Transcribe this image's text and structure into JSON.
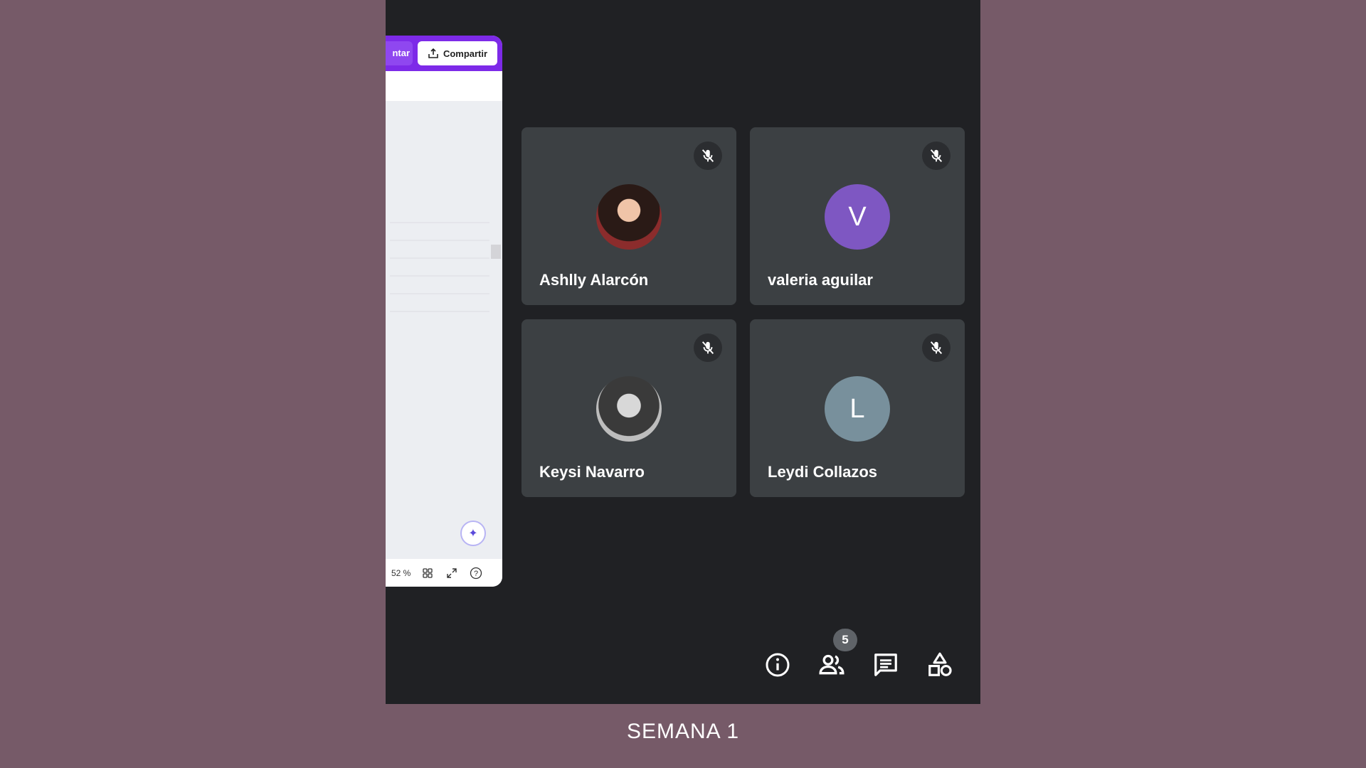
{
  "shared_screen": {
    "present_label": "ntar",
    "share_label": "Compartir",
    "zoom": "52 %"
  },
  "participants": [
    {
      "name": "Ashlly Alarcón",
      "initial": "",
      "avatar_type": "photo",
      "avatar_color": "#6b3a2a",
      "muted": true
    },
    {
      "name": "valeria aguilar",
      "initial": "V",
      "avatar_type": "letter",
      "avatar_color": "#7e57c2",
      "muted": true
    },
    {
      "name": "Keysi Navarro",
      "initial": "",
      "avatar_type": "photo",
      "avatar_color": "#9e9e9e",
      "muted": true
    },
    {
      "name": "Leydi Collazos",
      "initial": "L",
      "avatar_type": "letter",
      "avatar_color": "#78909c",
      "muted": true
    }
  ],
  "controls": {
    "participant_count": "5",
    "icons": [
      "info-icon",
      "people-icon",
      "chat-icon",
      "activities-icon"
    ]
  },
  "caption": "SEMANA 1"
}
